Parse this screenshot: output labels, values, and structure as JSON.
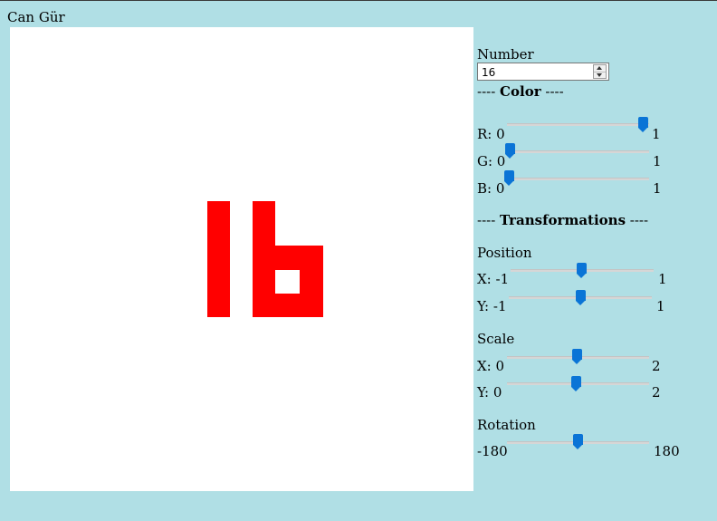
{
  "title": "Can Gür",
  "canvas": {
    "digits_color": "#ff0000",
    "background": "#ffffff"
  },
  "number": {
    "label": "Number",
    "value": "16"
  },
  "color": {
    "header": "Color",
    "sep_left": "---- ",
    "sep_right": " ----",
    "r": {
      "label": "R: 0",
      "max": "1",
      "value": 1
    },
    "g": {
      "label": "G: 0",
      "max": "1",
      "value": 0
    },
    "b": {
      "label": "B: 0",
      "max": "1",
      "value": 0
    }
  },
  "transform": {
    "header": "Transformations",
    "sep_left": "---- ",
    "sep_right": " ----",
    "position": {
      "label": "Position",
      "x": {
        "label": "X: -1",
        "max": "1",
        "value": 0
      },
      "y": {
        "label": "Y: -1",
        "max": "1",
        "value": 0
      }
    },
    "scale": {
      "label": "Scale",
      "x": {
        "label": "X: 0",
        "max": "2",
        "value": 1
      },
      "y": {
        "label": "Y: 0",
        "max": "2",
        "value": 1
      }
    },
    "rotation": {
      "label": "Rotation",
      "min_label": "-180",
      "max": "180",
      "value": 0
    }
  },
  "colors": {
    "page_bg": "#b0dfe5",
    "slider_accent": "#0a74d6"
  }
}
